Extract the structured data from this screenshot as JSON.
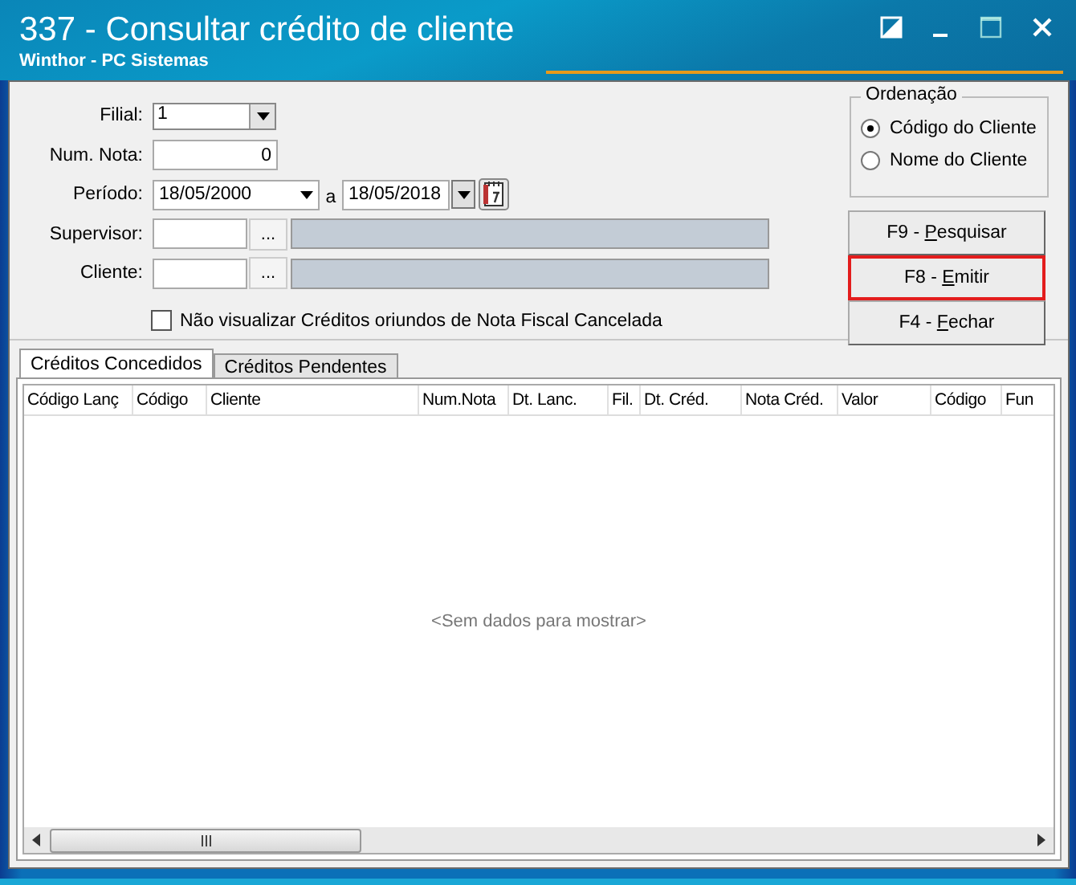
{
  "window": {
    "title": "337 - Consultar crédito de cliente",
    "subtitle": "Winthor - PC Sistemas"
  },
  "form": {
    "filial": {
      "label": "Filial:",
      "value": "1"
    },
    "num_nota": {
      "label": "Num. Nota:",
      "value": "0"
    },
    "periodo": {
      "label": "Período:",
      "from": "18/05/2000",
      "separator": "a",
      "to": "18/05/2018"
    },
    "supervisor": {
      "label": "Supervisor:",
      "lookup": "..."
    },
    "cliente": {
      "label": "Cliente:",
      "lookup": "..."
    },
    "checkbox": {
      "label": "Não visualizar Créditos oriundos de Nota Fiscal Cancelada",
      "checked": false
    }
  },
  "ordenacao": {
    "title": "Ordenação",
    "options": [
      {
        "label": "Código do Cliente",
        "selected": true
      },
      {
        "label": "Nome do Cliente",
        "selected": false
      }
    ]
  },
  "buttons": [
    {
      "prefix": "F9 -",
      "hotkey": "P",
      "rest": "esquisar",
      "highlighted": false
    },
    {
      "prefix": "F8 -",
      "hotkey": "E",
      "rest": "mitir",
      "highlighted": true
    },
    {
      "prefix": "F4 -",
      "hotkey": "F",
      "rest": "echar",
      "highlighted": false
    }
  ],
  "tabs": [
    {
      "label": "Créditos Concedidos",
      "selected": true
    },
    {
      "label": "Créditos Pendentes",
      "selected": false
    }
  ],
  "table": {
    "columns": [
      "Código Lanç",
      "Código",
      "Cliente",
      "Num.Nota",
      "Dt. Lanc.",
      "Fil.",
      "Dt. Créd.",
      "Nota Créd.",
      "Valor",
      "Código",
      "Fun"
    ],
    "empty_text": "<Sem dados para mostrar>"
  }
}
